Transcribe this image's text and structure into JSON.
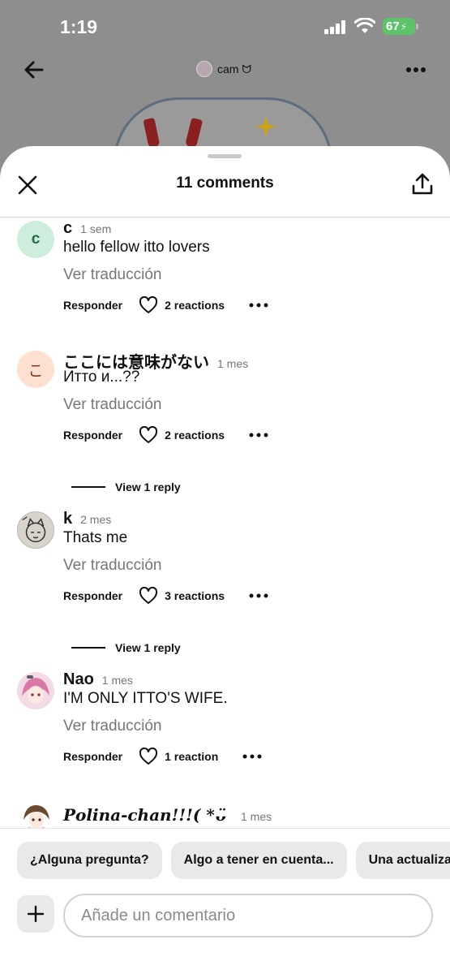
{
  "status_bar": {
    "time": "1:19",
    "battery": "67"
  },
  "pin_header": {
    "username": "cam ᗢ"
  },
  "sheet": {
    "title": "11 comments"
  },
  "comments": [
    {
      "avatar_letter": "c",
      "avatar_bg": "#cdeedd",
      "avatar_fg": "#1f6b45",
      "author": "c",
      "time": "1 sem",
      "text": "hello fellow itto lovers",
      "translate": "Ver traducción",
      "reply": "Responder",
      "reactions": "2 reactions"
    },
    {
      "avatar_letter": "こ",
      "avatar_bg": "#fde0cf",
      "avatar_fg": "#7a3a14",
      "author": "ここには意味がない",
      "time": "1 mes",
      "text": "Итто и...??",
      "translate": "Ver traducción",
      "reply": "Responder",
      "reactions": "2 reactions",
      "view_reply": "View 1 reply"
    },
    {
      "avatar_letter": "",
      "avatar_bg": "#d8d4cc",
      "avatar_fg": "#333333",
      "author": "k",
      "time": "2 mes",
      "text": "Thats me",
      "translate": "Ver traducción",
      "reply": "Responder",
      "reactions": "3 reactions",
      "view_reply": "View 1 reply"
    },
    {
      "avatar_letter": "",
      "avatar_bg": "#f3dbe6",
      "avatar_fg": "#333333",
      "author": "Nao",
      "time": "1 mes",
      "text": "I'M ONLY ITTO'S WIFE.",
      "translate": "Ver traducción",
      "reply": "Responder",
      "reactions": "1 reaction"
    }
  ],
  "partial_comment": {
    "author": "𝑷𝒐𝒍𝒊𝒏𝒂-𝒄𝒉𝒂𝒏!!!( *ᴗ̈",
    "time": "1 mes"
  },
  "composer": {
    "chips": [
      "¿Alguna pregunta?",
      "Algo a tener en cuenta...",
      "Una actualización"
    ],
    "placeholder": "Añade un comentario"
  }
}
